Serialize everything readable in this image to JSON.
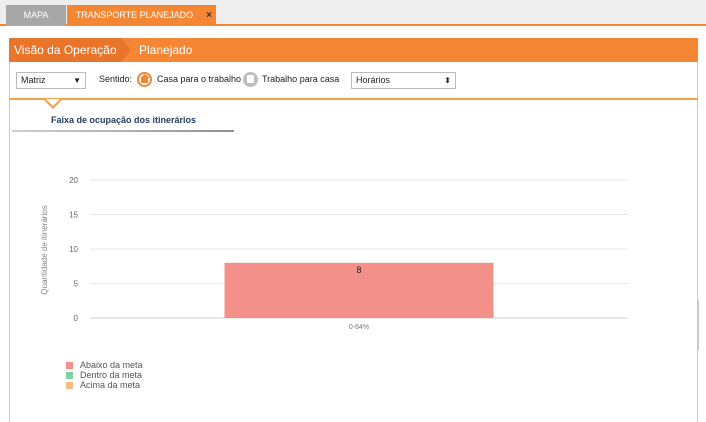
{
  "tabs": [
    {
      "label": "MAPA"
    },
    {
      "label": "TRANSPORTE PLANEJADO",
      "close": "×"
    }
  ],
  "breadcrumb": {
    "items": [
      "Visão da Operação",
      "Planejado"
    ]
  },
  "filters": {
    "unit_select": "Matriz",
    "sentido_label": "Sentido:",
    "direction_home": "Casa para o trabalho",
    "direction_work": "Trabalho para casa",
    "schedule_select": "Horários",
    "caret": "▼",
    "updown": "⬍"
  },
  "section": {
    "title": "Faixa de ocupação dos itinerários"
  },
  "chart_data": {
    "type": "bar",
    "categories": [
      "0-64%"
    ],
    "values": [
      8
    ],
    "data_labels": [
      "8"
    ],
    "ylabel": "Quantidade de itinerários",
    "ylim": [
      0,
      20
    ],
    "yticks": [
      0,
      5,
      10,
      15,
      20
    ],
    "grid": true,
    "bar_color": "#f4908a",
    "legend": [
      {
        "name": "Abaixo da meta",
        "color": "#f4908a"
      },
      {
        "name": "Dentro da meta",
        "color": "#7fd1a8"
      },
      {
        "name": "Acima da meta",
        "color": "#f7be84"
      }
    ],
    "legend_position": "bottom-left"
  },
  "colors": {
    "accent": "#f58634",
    "accent_dark": "#e8752a",
    "tab_inactive": "#a7a7a7"
  }
}
